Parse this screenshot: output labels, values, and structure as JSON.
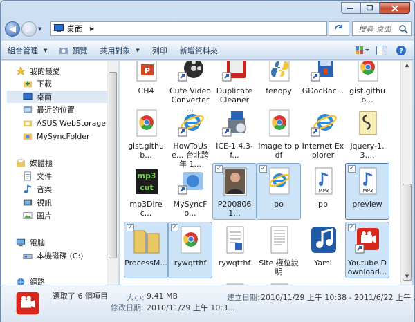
{
  "address": {
    "location": "桌面",
    "search_placeholder": "搜尋 桌面"
  },
  "toolbar": {
    "organize": "組合管理",
    "preview": "預覽",
    "share": "共用對象",
    "print": "列印",
    "new_folder": "新增資料夾"
  },
  "sidebar": {
    "items": [
      {
        "label": "我的最愛",
        "icon": "star-icon"
      },
      {
        "label": "下載",
        "icon": "download-folder-icon"
      },
      {
        "label": "桌面",
        "icon": "desktop-icon"
      },
      {
        "label": "最近的位置",
        "icon": "recent-places-icon"
      },
      {
        "label": "ASUS WebStorage Dr",
        "icon": "cloud-folder-icon"
      },
      {
        "label": "MySyncFolder",
        "icon": "sync-folder-icon"
      },
      {
        "label": "媒體櫃",
        "icon": "libraries-icon"
      },
      {
        "label": "文件",
        "icon": "documents-icon"
      },
      {
        "label": "音樂",
        "icon": "music-icon"
      },
      {
        "label": "視訊",
        "icon": "video-icon"
      },
      {
        "label": "圖片",
        "icon": "pictures-icon"
      },
      {
        "label": "電腦",
        "icon": "computer-icon"
      },
      {
        "label": "本機磁碟 (C:)",
        "icon": "drive-icon"
      },
      {
        "label": "網路",
        "icon": "network-icon"
      }
    ]
  },
  "files": [
    {
      "label": "CH4",
      "icon": "powerpoint-icon",
      "selected": false
    },
    {
      "label": "Cute Video Converter ...",
      "icon": "film-reel-icon",
      "selected": false
    },
    {
      "label": "Duplicate Cleaner",
      "icon": "duplicate-cleaner-icon",
      "selected": false
    },
    {
      "label": "fenopy",
      "icon": "python-icon",
      "selected": false
    },
    {
      "label": "GDocBac...",
      "icon": "gdocbackup-icon",
      "selected": false
    },
    {
      "label": "gist.github...",
      "icon": "chrome-icon",
      "selected": false
    },
    {
      "label": "gist.github...",
      "icon": "chrome-icon",
      "selected": false
    },
    {
      "label": "HowToUse... 台北跨年 1...",
      "icon": "ie-icon",
      "selected": false
    },
    {
      "label": "ICE-1.4.3-f...",
      "icon": "installer-icon",
      "selected": false
    },
    {
      "label": "image to pdf",
      "icon": "chrome-icon",
      "selected": false
    },
    {
      "label": "Internet Explorer",
      "icon": "ie-icon",
      "selected": false
    },
    {
      "label": "jquery-1.3....",
      "icon": "script-icon",
      "selected": false
    },
    {
      "label": "mp3Direc...",
      "icon": "mp3directcut-icon",
      "selected": false
    },
    {
      "label": "MySyncFo...",
      "icon": "sync-shortcut-icon",
      "selected": false
    },
    {
      "label": "P2008061...",
      "icon": "photo-icon",
      "selected": true
    },
    {
      "label": "po",
      "icon": "ie-icon",
      "selected": true
    },
    {
      "label": "pp",
      "icon": "mp3-file-icon",
      "selected": false
    },
    {
      "label": "preview",
      "icon": "mp3-file-icon",
      "selected": true
    },
    {
      "label": "ProcessM...",
      "icon": "zip-icon",
      "selected": true
    },
    {
      "label": "rywqtthf",
      "icon": "chrome-icon",
      "selected": true
    },
    {
      "label": "rywqtthf",
      "icon": "document-icon",
      "selected": false
    },
    {
      "label": "Site 權位說明",
      "icon": "text-file-icon",
      "selected": false
    },
    {
      "label": "Yami",
      "icon": "music-app-icon",
      "selected": false
    },
    {
      "label": "Youtube Download...",
      "icon": "youtube-downloader-icon",
      "selected": true
    }
  ],
  "status": {
    "selected_text": "選取了 6 個項目",
    "size_label": "大小:",
    "size_value": "9.41 MB",
    "modified_label": "修改日期:",
    "modified_value": "2010/11/29 上午 10:3...",
    "created_label": "建立日期:",
    "created_value": "2010/11/29 上午 10:38 - 2011/6/22 上午 ..."
  }
}
